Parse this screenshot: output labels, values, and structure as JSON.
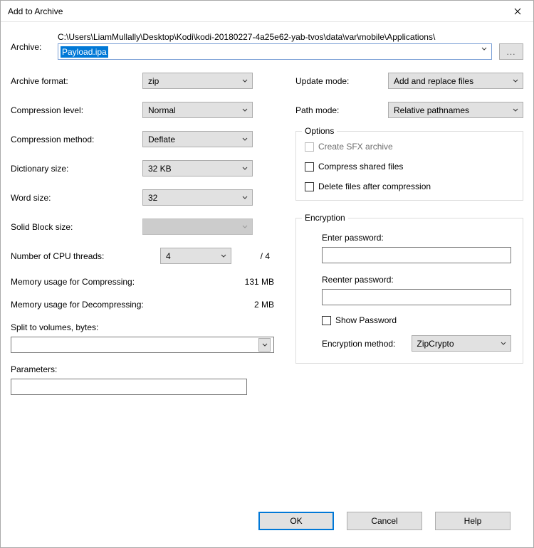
{
  "title": "Add to Archive",
  "archive": {
    "label": "Archive:",
    "path": "C:\\Users\\LiamMullally\\Desktop\\Kodi\\kodi-20180227-4a25e62-yab-tvos\\data\\var\\mobile\\Applications\\",
    "filename": "Payload.ipa",
    "browse": "..."
  },
  "left": {
    "format_label": "Archive format:",
    "format_value": "zip",
    "level_label": "Compression level:",
    "level_value": "Normal",
    "method_label": "Compression method:",
    "method_value": "Deflate",
    "dict_label": "Dictionary size:",
    "dict_value": "32 KB",
    "word_label": "Word size:",
    "word_value": "32",
    "solid_label": "Solid Block size:",
    "solid_value": "",
    "cpu_label": "Number of CPU threads:",
    "cpu_value": "4",
    "cpu_total": "/ 4",
    "mem_comp_label": "Memory usage for Compressing:",
    "mem_comp_value": "131 MB",
    "mem_decomp_label": "Memory usage for Decompressing:",
    "mem_decomp_value": "2 MB",
    "split_label": "Split to volumes, bytes:",
    "param_label": "Parameters:"
  },
  "right": {
    "update_label": "Update mode:",
    "update_value": "Add and replace files",
    "pathmode_label": "Path mode:",
    "pathmode_value": "Relative pathnames",
    "options_legend": "Options",
    "opt_sfx": "Create SFX archive",
    "opt_shared": "Compress shared files",
    "opt_delete": "Delete files after compression",
    "enc_legend": "Encryption",
    "enc_enter": "Enter password:",
    "enc_reenter": "Reenter password:",
    "enc_show": "Show Password",
    "enc_method_label": "Encryption method:",
    "enc_method_value": "ZipCrypto"
  },
  "buttons": {
    "ok": "OK",
    "cancel": "Cancel",
    "help": "Help"
  }
}
